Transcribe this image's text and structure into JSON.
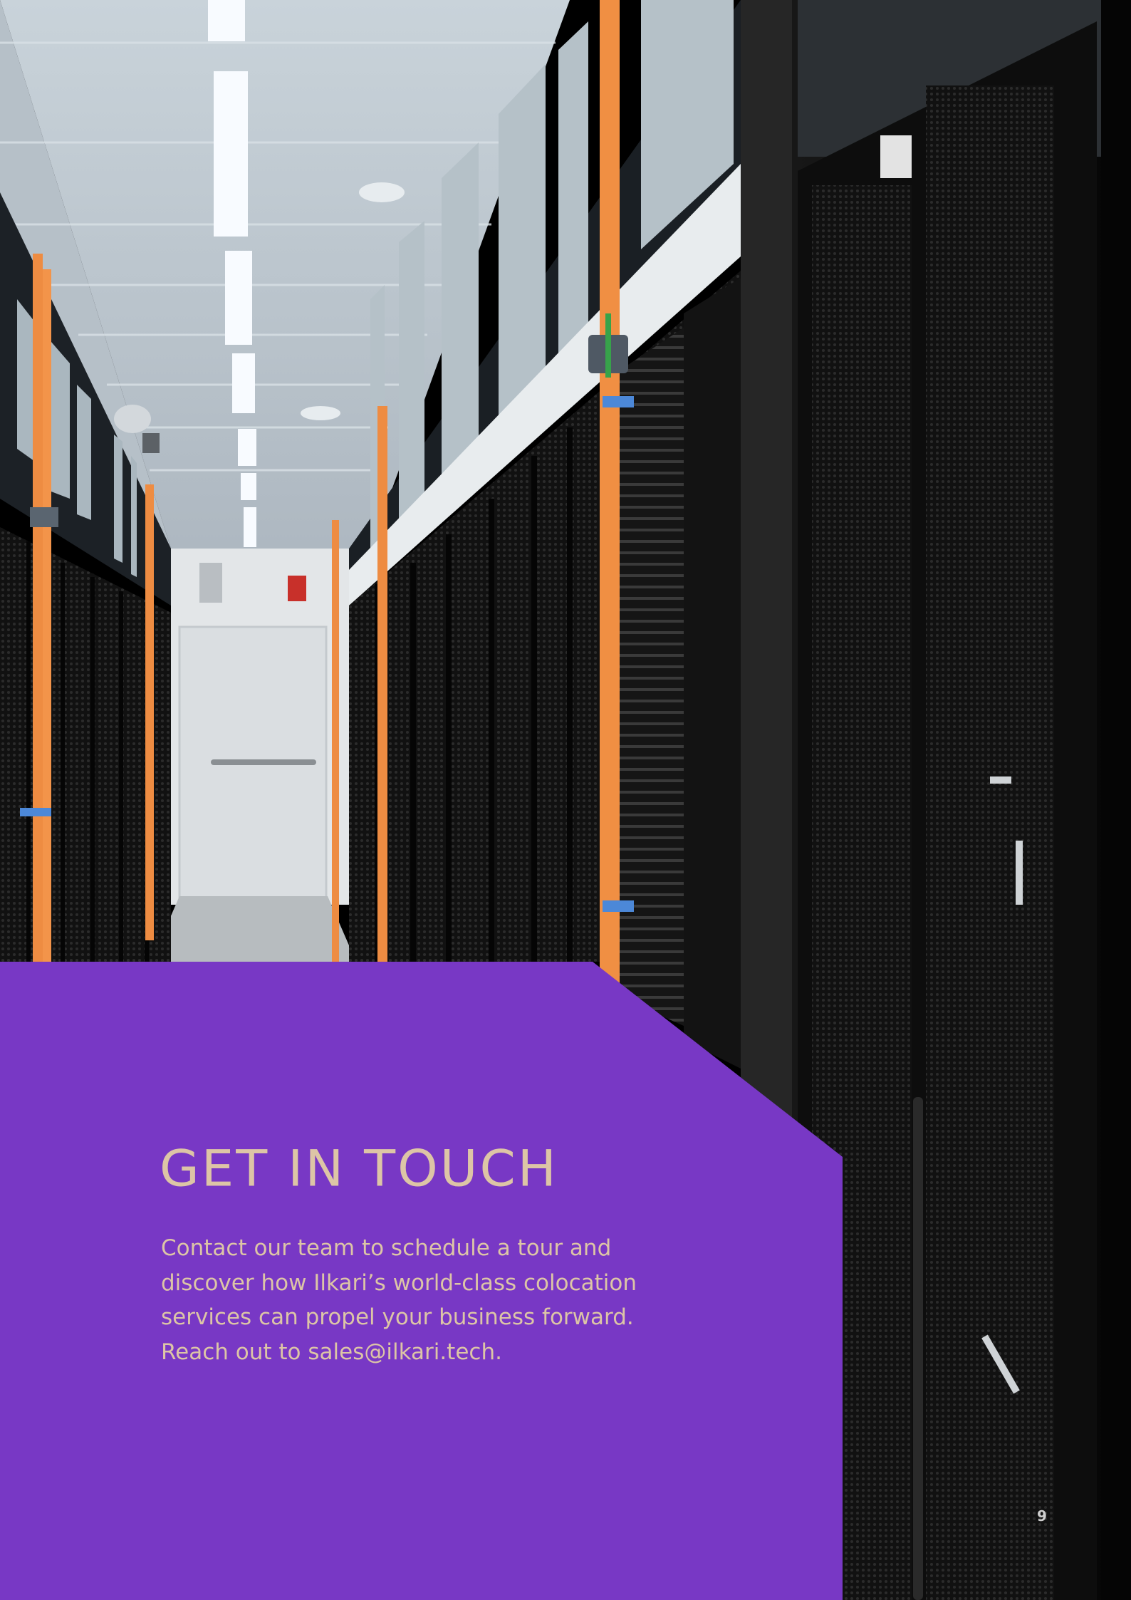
{
  "heading": "GET IN TOUCH",
  "body": "Contact our team to schedule a tour and discover how Ilkari’s world-class colocation services can propel your business forward. Reach out to sales@ilkari.tech.",
  "page_number": "9",
  "colors": {
    "panel": "#7838c5",
    "text": "#ddc5a6"
  },
  "photo": {
    "subject": "server-room-corridor-photo"
  }
}
